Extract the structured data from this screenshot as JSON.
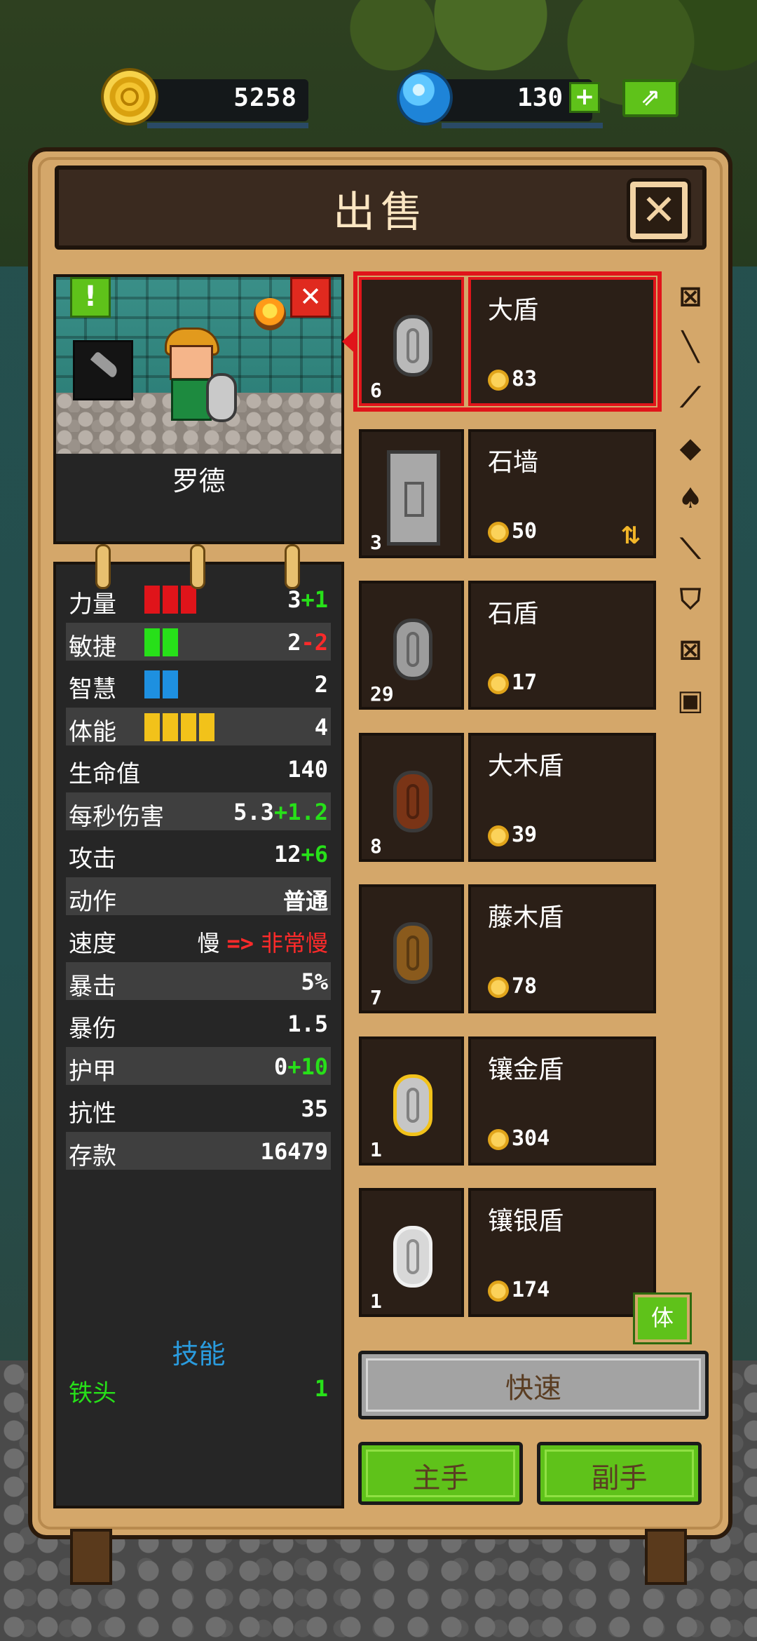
{
  "resources": {
    "coins": "5258",
    "gems": "130",
    "gem_plus_label": "+",
    "share_label": "⇗"
  },
  "dialog": {
    "title": "出售",
    "close_label": "✕"
  },
  "hero": {
    "name": "罗德",
    "alert_label": "!",
    "remove_label": "✕"
  },
  "stats": [
    {
      "label": "力量",
      "value": "3",
      "bonus": "+1",
      "bonus_type": "pos",
      "bar_count": 3,
      "bar_color": "#e0141a"
    },
    {
      "label": "敏捷",
      "value": "2",
      "bonus": "-2",
      "bonus_type": "neg",
      "bar_count": 2,
      "bar_color": "#27e019"
    },
    {
      "label": "智慧",
      "value": "2",
      "bonus": "",
      "bonus_type": "",
      "bar_count": 2,
      "bar_color": "#1e90e0"
    },
    {
      "label": "体能",
      "value": "4",
      "bonus": "",
      "bonus_type": "",
      "bar_count": 4,
      "bar_color": "#f2c21a"
    },
    {
      "label": "生命值",
      "value": "140",
      "bonus": "",
      "bonus_type": ""
    },
    {
      "label": "每秒伤害",
      "value": "5.3",
      "bonus": "+1.2",
      "bonus_type": "pos"
    },
    {
      "label": "攻击",
      "value": "12",
      "bonus": "+6",
      "bonus_type": "pos"
    },
    {
      "label": "动作",
      "value": "普通",
      "bonus": "",
      "bonus_type": ""
    },
    {
      "label": "速度",
      "value": "慢",
      "arrow": "=>",
      "bonus": "非常慢",
      "bonus_type": "neg"
    },
    {
      "label": "暴击",
      "value": "5%",
      "bonus": "",
      "bonus_type": ""
    },
    {
      "label": "暴伤",
      "value": "1.5",
      "bonus": "",
      "bonus_type": ""
    },
    {
      "label": "护甲",
      "value": "0",
      "bonus": "+10",
      "bonus_type": "pos"
    },
    {
      "label": "抗性",
      "value": "35",
      "bonus": "",
      "bonus_type": ""
    },
    {
      "label": "存款",
      "value": "16479",
      "bonus": "",
      "bonus_type": ""
    }
  ],
  "skills": {
    "title": "技能",
    "items": [
      {
        "name": "铁头",
        "level": "1"
      }
    ]
  },
  "items": [
    {
      "name": "大盾",
      "count": "6",
      "price": "83",
      "icon": "shield-icon",
      "color": "#b9b9b9",
      "selected": true
    },
    {
      "name": "石墙",
      "count": "3",
      "price": "50",
      "icon": "stone-wall-icon",
      "color": "#a8a8a8",
      "upgrade": "⇅"
    },
    {
      "name": "石盾",
      "count": "29",
      "price": "17",
      "icon": "shield-icon",
      "color": "#9c9c9c"
    },
    {
      "name": "大木盾",
      "count": "8",
      "price": "39",
      "icon": "shield-icon",
      "color": "#7a3416"
    },
    {
      "name": "藤木盾",
      "count": "7",
      "price": "78",
      "icon": "shield-icon",
      "color": "#8a5a1c"
    },
    {
      "name": "镶金盾",
      "count": "1",
      "price": "304",
      "icon": "shield-icon",
      "color": "#c6c6c6",
      "trim": "#f2c21a"
    },
    {
      "name": "镶银盾",
      "count": "1",
      "price": "174",
      "icon": "shield-icon",
      "color": "#d8d8d8",
      "trim": "#f0f0f0"
    }
  ],
  "categories": [
    {
      "icon": "all-icon",
      "glyph": "⊠"
    },
    {
      "icon": "dagger-icon",
      "glyph": "╲"
    },
    {
      "icon": "sword-icon",
      "glyph": "⟋"
    },
    {
      "icon": "mace-icon",
      "glyph": "◆"
    },
    {
      "icon": "axe-icon",
      "glyph": "♠"
    },
    {
      "icon": "spear-icon",
      "glyph": "⟍"
    },
    {
      "icon": "shield-icon",
      "glyph": "⛉"
    },
    {
      "icon": "bow-icon",
      "glyph": "⊠"
    },
    {
      "icon": "armor-icon",
      "glyph": "▣"
    }
  ],
  "filter_label": "体",
  "buttons": {
    "quick": "快速",
    "main_hand": "主手",
    "off_hand": "副手"
  }
}
